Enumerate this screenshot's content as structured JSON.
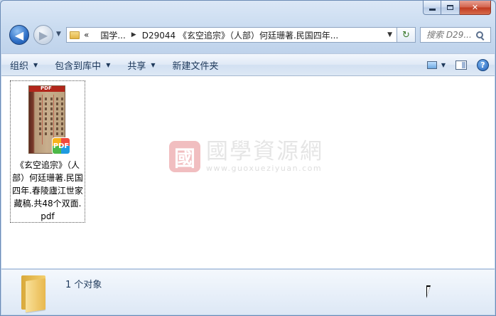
{
  "window": {
    "caption_buttons": {
      "min": "minimize",
      "max": "maximize",
      "close": "✕"
    }
  },
  "nav": {
    "address_crumbs": [
      "«",
      "国学...",
      "D29044 《玄空追宗》（人部）何廷珊著.民国四年..."
    ],
    "search_placeholder": "搜索 D29...",
    "back_glyph": "◀",
    "forward_glyph": "▶",
    "refresh_glyph": "↻"
  },
  "toolbar": {
    "organize": "组织",
    "include_in_library": "包含到库中",
    "share": "共享",
    "new_folder": "新建文件夹",
    "help": "?"
  },
  "files": [
    {
      "name": "《玄空追宗》（人部）何廷珊著.民国四年.春陵廬江世家藏稿.共48个双面.pdf",
      "badge": "PDF",
      "thumb_band": "PDF"
    }
  ],
  "watermark": {
    "seal_char": "國",
    "title": "國學資源網",
    "url": "www.guoxueziyuan.com"
  },
  "details": {
    "count": "1 个对象"
  },
  "colors": {
    "accent": "#1e395b",
    "close_red": "#c0391f",
    "seal_red": "#d8474d"
  }
}
